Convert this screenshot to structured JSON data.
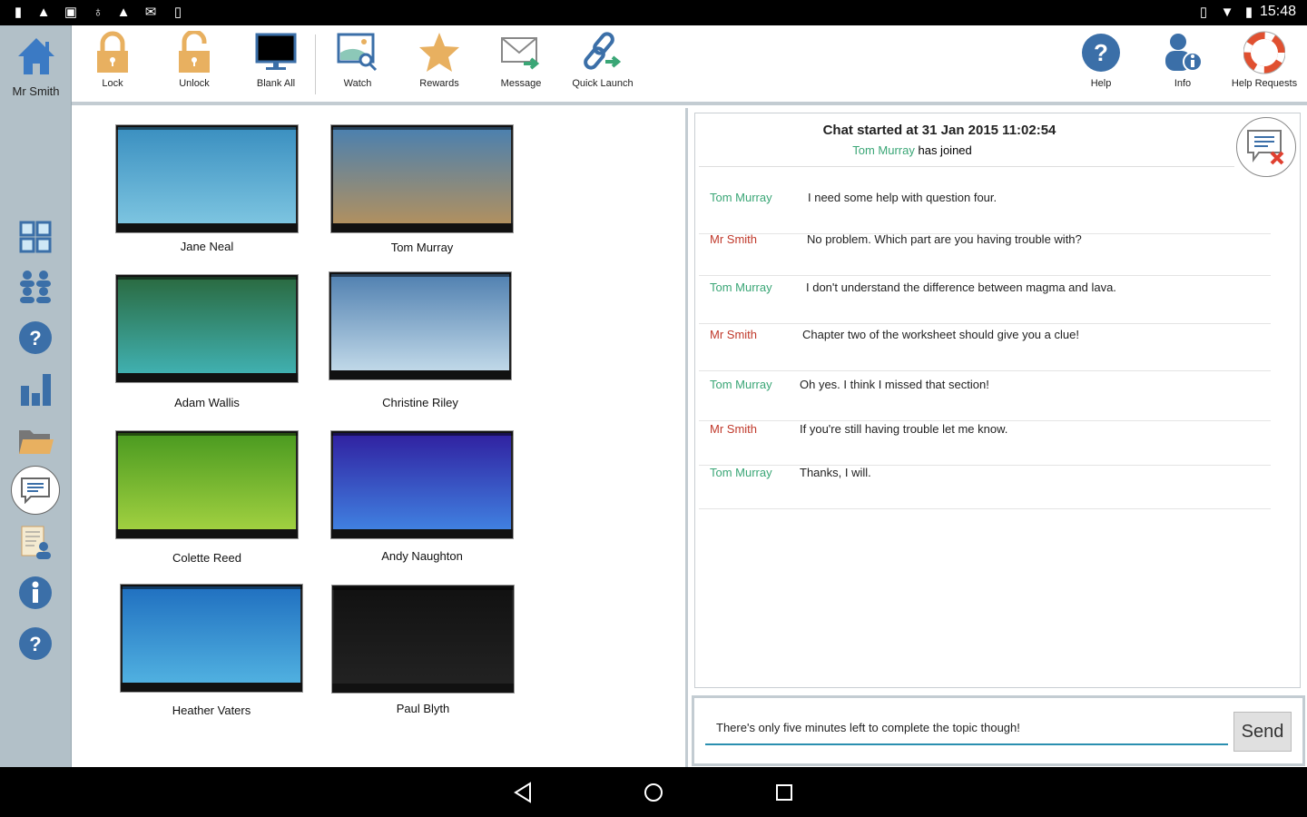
{
  "status_bar": {
    "time": "15:48",
    "icons": [
      "battery-alert-icon",
      "warning-icon",
      "image-icon",
      "android-icon",
      "warning-icon",
      "gmail-icon",
      "download-icon"
    ],
    "right_icons": [
      "vibrate-icon",
      "wifi-icon",
      "battery-icon"
    ]
  },
  "user": {
    "name": "Mr Smith"
  },
  "toolbar": {
    "items": [
      {
        "label": "Lock",
        "icon": "lock-icon"
      },
      {
        "label": "Unlock",
        "icon": "unlock-icon"
      },
      {
        "label": "Blank All",
        "icon": "monitor-icon"
      },
      {
        "label": "Watch",
        "icon": "watch-icon"
      },
      {
        "label": "Rewards",
        "icon": "star-icon"
      },
      {
        "label": "Message",
        "icon": "message-icon"
      },
      {
        "label": "Quick Launch",
        "icon": "link-icon"
      }
    ],
    "right_items": [
      {
        "label": "Help",
        "icon": "help-icon"
      },
      {
        "label": "Info",
        "icon": "user-info-icon"
      },
      {
        "label": "Help Requests",
        "icon": "lifebuoy-icon"
      }
    ]
  },
  "sidebar": {
    "items": [
      "thumbnails-icon",
      "groups-icon",
      "question-icon",
      "chart-icon",
      "folder-icon",
      "chat-icon",
      "register-icon",
      "info-icon",
      "help-icon"
    ],
    "selected": "chat-icon"
  },
  "students": [
    {
      "name": "Jane Neal",
      "bg": [
        "#3a8fc0",
        "#7cc4e0"
      ]
    },
    {
      "name": "Tom Murray",
      "bg": [
        "#4a80b0",
        "#b09060"
      ]
    },
    {
      "name": "Adam Wallis",
      "bg": [
        "#2a6a40",
        "#40b0b0"
      ]
    },
    {
      "name": "Christine Riley",
      "bg": [
        "#5080b0",
        "#c0d8e8"
      ]
    },
    {
      "name": "Colette Reed",
      "bg": [
        "#4a9a20",
        "#a0d040"
      ]
    },
    {
      "name": "Andy Naughton",
      "bg": [
        "#3020a0",
        "#4080e0"
      ]
    },
    {
      "name": "Heather Vaters",
      "bg": [
        "#2070c0",
        "#50b0e0"
      ]
    },
    {
      "name": "Paul Blyth",
      "bg": [
        "#111111",
        "#222222"
      ]
    }
  ],
  "chat": {
    "title": "Chat started at 31 Jan 2015 11:02:54",
    "joined_name": "Tom Murray",
    "joined_text": "has joined",
    "colors": {
      "student": "#3aa676",
      "teacher": "#c0392b"
    },
    "messages": [
      {
        "from": "Tom Murray",
        "role": "student",
        "text": "I need some help with question four."
      },
      {
        "from": "Mr Smith",
        "role": "teacher",
        "text": "No problem. Which part are you having trouble with?"
      },
      {
        "from": "Tom Murray",
        "role": "student",
        "text": "I don't understand the difference between magma and lava."
      },
      {
        "from": "Mr Smith",
        "role": "teacher",
        "text": "Chapter two of the worksheet should give you a clue!"
      },
      {
        "from": "Tom Murray",
        "role": "student",
        "text": "Oh yes. I think I missed that section!"
      },
      {
        "from": "Mr Smith",
        "role": "teacher",
        "text": "If you're still having trouble let me know."
      },
      {
        "from": "Tom Murray",
        "role": "student",
        "text": "Thanks, I will."
      }
    ],
    "input_value": "There's only five minutes left to complete the topic though!",
    "send_label": "Send"
  }
}
